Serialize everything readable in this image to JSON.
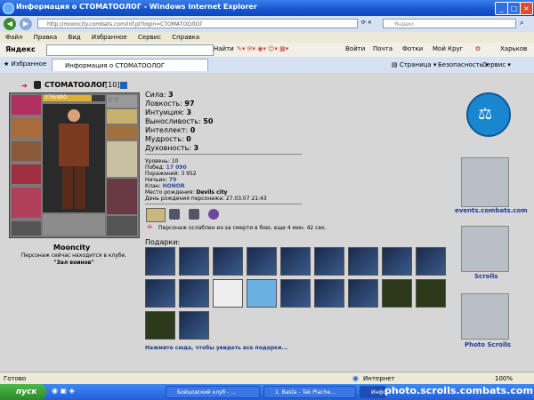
{
  "window": {
    "title": "Информация о СТОМАТООЛОГ - Windows Internet Explorer",
    "address": "http://mooncity.combats.com/inf.pl?login=СТОМАТООЛОГ",
    "search_engine": "Яндекс"
  },
  "menu": [
    "Файл",
    "Правка",
    "Вид",
    "Избранное",
    "Сервис",
    "Справка"
  ],
  "yandex_bar": {
    "logo": "Яндекс",
    "find": "Найти",
    "links": [
      "Войти",
      "Почта",
      "Фотки",
      "Мой Круг"
    ],
    "city": "Харьков"
  },
  "tabs": {
    "favorites": "Избранное",
    "active_tab": "Информация о СТОМАТООЛОГ",
    "right": [
      "Страница",
      "Безопасность",
      "Сервис"
    ]
  },
  "character": {
    "name": "СТОМАТООЛОГ",
    "level_tag": "[10]",
    "hp_text": "376/480",
    "stats": [
      {
        "label": "Сила:",
        "value": "3"
      },
      {
        "label": "Ловкость:",
        "value": "97"
      },
      {
        "label": "Интуиция:",
        "value": "3"
      },
      {
        "label": "Выносливость:",
        "value": "50"
      },
      {
        "label": "Интеллект:",
        "value": "0"
      },
      {
        "label": "Мудрость:",
        "value": "0"
      },
      {
        "label": "Духовность:",
        "value": "3"
      }
    ],
    "info": [
      {
        "label": "Уровень:",
        "value": "10"
      },
      {
        "label": "Побед:",
        "value": "17 090"
      },
      {
        "label": "Поражений:",
        "value": "3 952"
      },
      {
        "label": "Ничьих:",
        "value": "79"
      },
      {
        "label": "Клан:",
        "value": "HONOR"
      },
      {
        "label": "Место рождения:",
        "value": "Devils city"
      },
      {
        "label": "День рождения персонажа:",
        "value": "27.03.07 21:43"
      }
    ],
    "weakened": "Персонаж ослаблен из-за смерти в бою, еще 4 мин. 42 сек.",
    "city_name": "Mooncity",
    "location_text": "Персонаж сейчас находится в клубе.",
    "location_place": "\"Зал воинов\""
  },
  "gifts": {
    "label": "Подарки:",
    "more_link": "Нажмите сюда, чтобы увидеть все подарки..."
  },
  "banners": {
    "events": "events.combats.com",
    "scrolls": "Scrolls",
    "photo": "Photo Scrolls"
  },
  "statusbar": {
    "left": "Готово",
    "zone": "Интернет",
    "zoom": "100%"
  },
  "taskbar": {
    "start": "пуск",
    "tasks": [
      "Бойцовский клуб - ...",
      "1. Basta - Tak Plache...",
      "Информац..."
    ],
    "watermark": "photo.scrolls.combats.com"
  }
}
